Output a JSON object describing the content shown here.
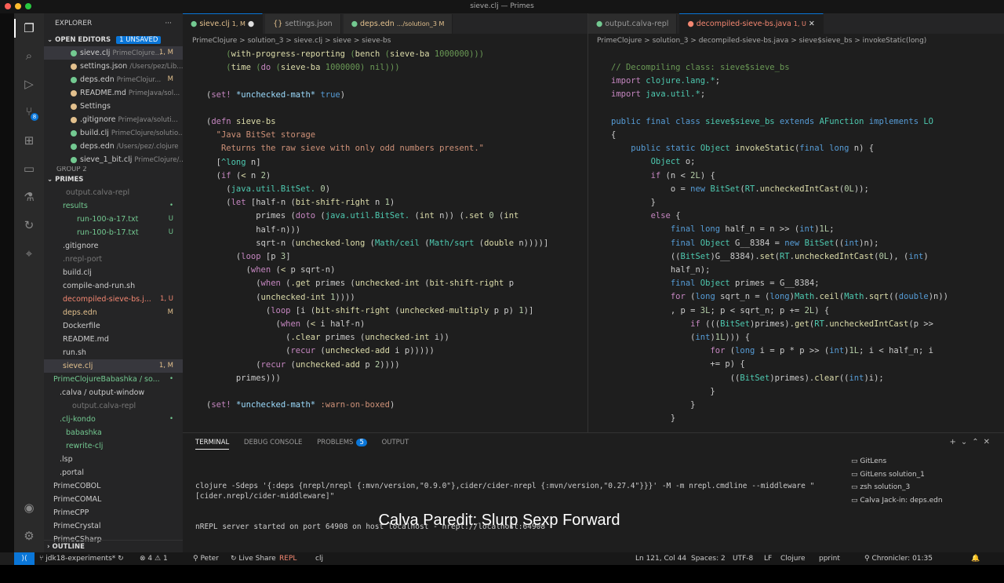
{
  "window_title": "sieve.clj — Primes",
  "explorer": {
    "title": "EXPLORER",
    "open_editors_label": "OPEN EDITORS",
    "unsaved": "1 UNSAVED",
    "open_editors": [
      {
        "name": "sieve.clj",
        "path": "PrimeClojure...",
        "status": "1, M",
        "cls": "mod"
      },
      {
        "name": "settings.json",
        "path": "/Users/pez/Lib...",
        "status": "",
        "cls": ""
      },
      {
        "name": "deps.edn",
        "path": "PrimeClojur...",
        "status": "M",
        "cls": "mod"
      },
      {
        "name": "README.md",
        "path": "PrimeJava/sol...",
        "status": "",
        "cls": ""
      },
      {
        "name": "Settings",
        "path": "",
        "status": "",
        "cls": ""
      },
      {
        "name": ".gitignore",
        "path": "PrimeJava/soluti...",
        "status": "",
        "cls": ""
      },
      {
        "name": "build.clj",
        "path": "PrimeClojure/solutio...",
        "status": "",
        "cls": ""
      },
      {
        "name": "deps.edn",
        "path": "/Users/pez/.clojure",
        "status": "",
        "cls": ""
      },
      {
        "name": "sieve_1_bit.clj",
        "path": "PrimeClojure/...",
        "status": "",
        "cls": ""
      }
    ],
    "group": "GROUP 2",
    "primes_label": "PRIMES",
    "tree": [
      {
        "name": "output.calva-repl",
        "status": "",
        "cls": "dimrow",
        "indent": 28
      },
      {
        "name": "results",
        "status": "•",
        "cls": "unt",
        "indent": 24
      },
      {
        "name": "run-100-a-17.txt",
        "status": "U",
        "cls": "unt",
        "indent": 42
      },
      {
        "name": "run-100-b-17.txt",
        "status": "U",
        "cls": "unt",
        "indent": 42
      },
      {
        "name": ".gitignore",
        "status": "",
        "cls": "",
        "indent": 24
      },
      {
        "name": ".nrepl-port",
        "status": "",
        "cls": "dimrow",
        "indent": 24
      },
      {
        "name": "build.clj",
        "status": "",
        "cls": "",
        "indent": 24
      },
      {
        "name": "compile-and-run.sh",
        "status": "",
        "cls": "",
        "indent": 24
      },
      {
        "name": "decompiled-sieve-bs.j...",
        "status": "1, U",
        "cls": "err",
        "indent": 24
      },
      {
        "name": "deps.edn",
        "status": "M",
        "cls": "mod",
        "indent": 24
      },
      {
        "name": "Dockerfile",
        "status": "",
        "cls": "",
        "indent": 24
      },
      {
        "name": "README.md",
        "status": "",
        "cls": "",
        "indent": 24
      },
      {
        "name": "run.sh",
        "status": "",
        "cls": "",
        "indent": 24
      },
      {
        "name": "sieve.clj",
        "status": "1, M",
        "cls": "mod",
        "indent": 24
      },
      {
        "name": "PrimeClojureBabashka / so...",
        "status": "•",
        "cls": "unt",
        "indent": 12
      },
      {
        "name": ".calva / output-window",
        "status": "",
        "cls": "",
        "indent": 20
      },
      {
        "name": "output.calva-repl",
        "status": "",
        "cls": "dimrow",
        "indent": 36
      },
      {
        "name": ".clj-kondo",
        "status": "•",
        "cls": "unt",
        "indent": 20
      },
      {
        "name": "babashka",
        "status": "",
        "cls": "unt",
        "indent": 28
      },
      {
        "name": "rewrite-clj",
        "status": "",
        "cls": "unt",
        "indent": 28
      },
      {
        "name": ".lsp",
        "status": "",
        "cls": "",
        "indent": 20
      },
      {
        "name": ".portal",
        "status": "",
        "cls": "",
        "indent": 20
      },
      {
        "name": "PrimeCOBOL",
        "status": "",
        "cls": "",
        "indent": 12
      },
      {
        "name": "PrimeCOMAL",
        "status": "",
        "cls": "",
        "indent": 12
      },
      {
        "name": "PrimeCPP",
        "status": "",
        "cls": "",
        "indent": 12
      },
      {
        "name": "PrimeCrystal",
        "status": "",
        "cls": "",
        "indent": 12
      },
      {
        "name": "PrimeCSharp",
        "status": "",
        "cls": "",
        "indent": 12
      }
    ],
    "outline": "OUTLINE"
  },
  "left_editor": {
    "tabs": [
      {
        "label": "sieve.clj",
        "extra": "1, M"
      },
      {
        "label": "settings.json",
        "extra": ""
      },
      {
        "label": "deps.edn",
        "extra": ".../solution_3  M"
      }
    ],
    "breadcrumb": "PrimeClojure  >  solution_3  >  sieve.clj  >  sieve  >  sieve-bs"
  },
  "right_editor": {
    "tabs": [
      {
        "label": "output.calva-repl",
        "extra": ""
      },
      {
        "label": "decompiled-sieve-bs.java",
        "extra": "1, U"
      }
    ],
    "breadcrumb": "PrimeClojure  >  solution_3  >  decompiled-sieve-bs.java  >  sieve$sieve_bs  >  invokeStatic(long)"
  },
  "panel": {
    "tabs": [
      "TERMINAL",
      "DEBUG CONSOLE",
      "PROBLEMS",
      "OUTPUT"
    ],
    "problems_count": "5",
    "terminal_lines": [
      "clojure -Sdeps '{:deps {nrepl/nrepl {:mvn/version,\"0.9.0\"},cider/cider-nrepl {:mvn/version,\"0.27.4\"}}}' -M -m nrepl.cmdline --middleware \"[cider.nrepl/cider-middleware]\"",
      "nREPL server started on port 64908 on host localhost - nrepl://localhost:64908"
    ],
    "terminals": [
      "GitLens",
      "GitLens  solution_1",
      "zsh  solution_3",
      "Calva Jack-in: deps.edn"
    ]
  },
  "caption": "Calva Paredit: Slurp Sexp Forward",
  "status": {
    "branch": "jdk18-experiments*",
    "errors": "4",
    "warnings": "1",
    "user": "Peter",
    "live_share": "Live Share",
    "repl": "REPL",
    "lang_ns": "clj",
    "position": "Ln 121, Col 44",
    "spaces": "Spaces: 2",
    "encoding": "UTF-8",
    "eol": "LF",
    "language": "Clojure",
    "formatter": "pprint",
    "chronicler": "Chronicler: 01:35"
  }
}
